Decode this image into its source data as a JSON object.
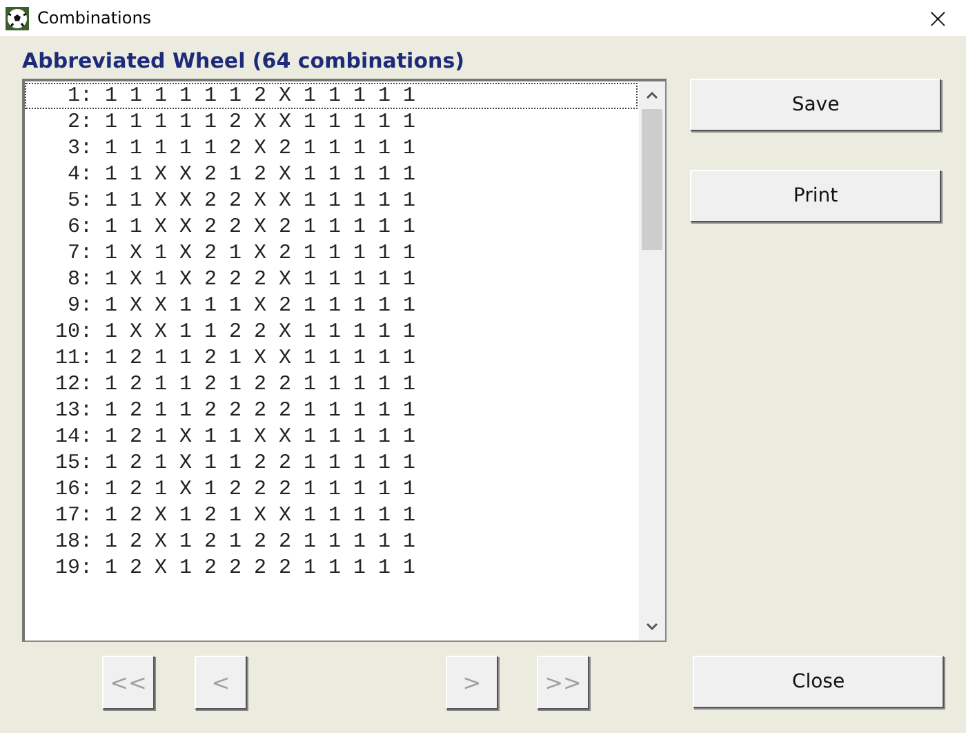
{
  "window": {
    "title": "Combinations",
    "close": "×"
  },
  "heading": "Abbreviated Wheel (64 combinations)",
  "rows": [
    {
      "index": "1:",
      "picks": "1 1 1 1 1 1 2 X 1 1 1 1 1",
      "selected": true
    },
    {
      "index": "2:",
      "picks": "1 1 1 1 1 2 X X 1 1 1 1 1",
      "selected": false
    },
    {
      "index": "3:",
      "picks": "1 1 1 1 1 2 X 2 1 1 1 1 1",
      "selected": false
    },
    {
      "index": "4:",
      "picks": "1 1 X X 2 1 2 X 1 1 1 1 1",
      "selected": false
    },
    {
      "index": "5:",
      "picks": "1 1 X X 2 2 X X 1 1 1 1 1",
      "selected": false
    },
    {
      "index": "6:",
      "picks": "1 1 X X 2 2 X 2 1 1 1 1 1",
      "selected": false
    },
    {
      "index": "7:",
      "picks": "1 X 1 X 2 1 X 2 1 1 1 1 1",
      "selected": false
    },
    {
      "index": "8:",
      "picks": "1 X 1 X 2 2 2 X 1 1 1 1 1",
      "selected": false
    },
    {
      "index": "9:",
      "picks": "1 X X 1 1 1 X 2 1 1 1 1 1",
      "selected": false
    },
    {
      "index": "10:",
      "picks": "1 X X 1 1 2 2 X 1 1 1 1 1",
      "selected": false
    },
    {
      "index": "11:",
      "picks": "1 2 1 1 2 1 X X 1 1 1 1 1",
      "selected": false
    },
    {
      "index": "12:",
      "picks": "1 2 1 1 2 1 2 2 1 1 1 1 1",
      "selected": false
    },
    {
      "index": "13:",
      "picks": "1 2 1 1 2 2 2 2 1 1 1 1 1",
      "selected": false
    },
    {
      "index": "14:",
      "picks": "1 2 1 X 1 1 X X 1 1 1 1 1",
      "selected": false
    },
    {
      "index": "15:",
      "picks": "1 2 1 X 1 1 2 2 1 1 1 1 1",
      "selected": false
    },
    {
      "index": "16:",
      "picks": "1 2 1 X 1 2 2 2 1 1 1 1 1",
      "selected": false
    },
    {
      "index": "17:",
      "picks": "1 2 X 1 2 1 X X 1 1 1 1 1",
      "selected": false
    },
    {
      "index": "18:",
      "picks": "1 2 X 1 2 1 2 2 1 1 1 1 1",
      "selected": false
    },
    {
      "index": "19:",
      "picks": "1 2 X 1 2 2 2 2 1 1 1 1 1",
      "selected": false
    }
  ],
  "side_buttons": [
    {
      "label": "Save"
    },
    {
      "label": "Print"
    }
  ],
  "nav_buttons": [
    {
      "label": "<<",
      "disabled": true
    },
    {
      "label": "<",
      "disabled": true
    },
    {
      "label": ">",
      "disabled": true
    },
    {
      "label": ">>",
      "disabled": true
    }
  ],
  "close_button": {
    "label": "Close"
  }
}
